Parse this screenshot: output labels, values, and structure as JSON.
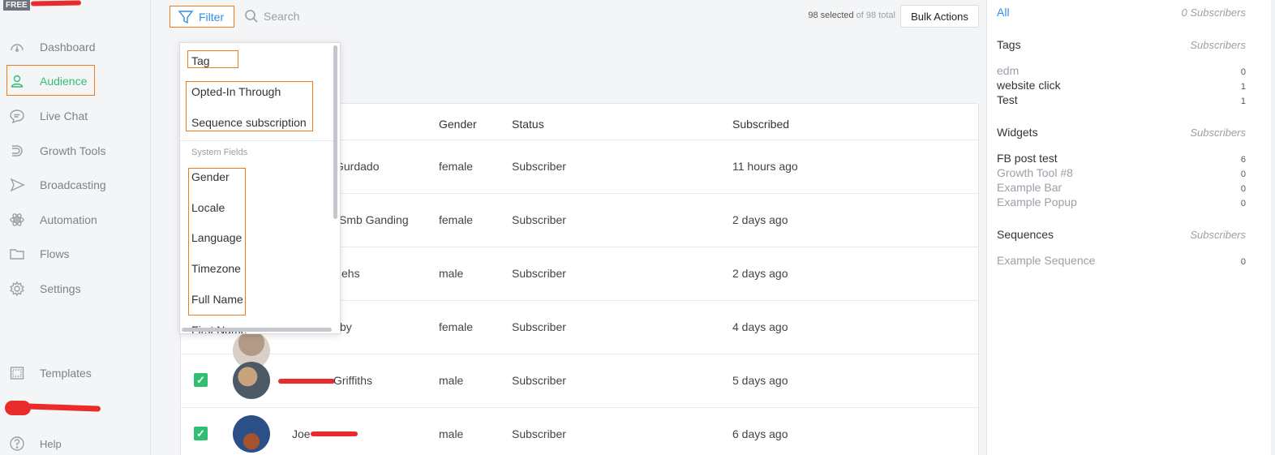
{
  "sidebar": {
    "badge": "FREE",
    "items": [
      {
        "label": "Dashboard",
        "icon": "dashboard-icon"
      },
      {
        "label": "Audience",
        "icon": "user-icon"
      },
      {
        "label": "Live Chat",
        "icon": "chat-icon"
      },
      {
        "label": "Growth Tools",
        "icon": "growth-icon"
      },
      {
        "label": "Broadcasting",
        "icon": "send-icon"
      },
      {
        "label": "Automation",
        "icon": "atom-icon"
      },
      {
        "label": "Flows",
        "icon": "folder-icon"
      },
      {
        "label": "Settings",
        "icon": "gear-icon"
      }
    ],
    "templates": {
      "label": "Templates",
      "icon": "templates-icon"
    },
    "help": {
      "label": "Help",
      "icon": "help-icon"
    }
  },
  "toolbar": {
    "filter_label": "Filter",
    "search_placeholder": "Search",
    "selected_count": "98 selected",
    "selected_total": "of 98 total",
    "bulk_actions_label": "Bulk Actions"
  },
  "filter_dropdown": {
    "top_items": [
      "Tag",
      "Opted-In Through",
      "Sequence subscription"
    ],
    "section_label": "System Fields",
    "system_items": [
      "Gender",
      "Locale",
      "Language",
      "Timezone",
      "Full Name",
      "First Name"
    ]
  },
  "table": {
    "columns": {
      "gender": "Gender",
      "status": "Status",
      "subscribed": "Subscribed"
    },
    "rows": [
      {
        "name": "Gurdado",
        "gender": "female",
        "status": "Subscriber",
        "subscribed": "11 hours ago"
      },
      {
        "name": "Smb Ganding",
        "gender": "female",
        "status": "Subscriber",
        "subscribed": "2 days ago"
      },
      {
        "name": "ehs",
        "gender": "male",
        "status": "Subscriber",
        "subscribed": "2 days ago"
      },
      {
        "name": "by",
        "gender": "female",
        "status": "Subscriber",
        "subscribed": "4 days ago"
      },
      {
        "name": "Griffiths",
        "gender": "male",
        "status": "Subscriber",
        "subscribed": "5 days ago"
      },
      {
        "name": "Joe",
        "gender": "male",
        "status": "Subscriber",
        "subscribed": "6 days ago"
      }
    ]
  },
  "right_panel": {
    "all": {
      "label": "All",
      "subscribers": "0 Subscribers"
    },
    "tags": {
      "title": "Tags",
      "subtitle": "Subscribers",
      "items": [
        {
          "label": "edm",
          "count": "0"
        },
        {
          "label": "website click",
          "count": "1"
        },
        {
          "label": "Test",
          "count": "1"
        }
      ]
    },
    "widgets": {
      "title": "Widgets",
      "subtitle": "Subscribers",
      "items": [
        {
          "label": "FB post test",
          "count": "6"
        },
        {
          "label": "Growth Tool #8",
          "count": "0"
        },
        {
          "label": "Example Bar",
          "count": "0"
        },
        {
          "label": "Example Popup",
          "count": "0"
        }
      ]
    },
    "sequences": {
      "title": "Sequences",
      "subtitle": "Subscribers",
      "items": [
        {
          "label": "Example Sequence",
          "count": "0"
        }
      ]
    }
  },
  "colors": {
    "accent": "#2f8fe8",
    "active_green": "#2fbf71",
    "highlight_orange": "#f07b1d",
    "redaction_red": "#ea2b2b"
  }
}
